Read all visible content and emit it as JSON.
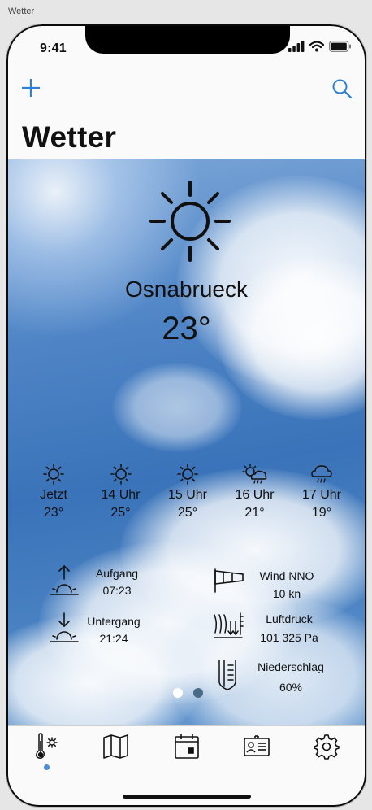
{
  "window": {
    "title": "Wetter"
  },
  "status_bar": {
    "time": "9:41"
  },
  "nav": {
    "title": "Wetter"
  },
  "weather": {
    "city": "Osnabrueck",
    "temperature": "23°",
    "hourly": [
      {
        "label": "Jetzt",
        "temp": "23°",
        "icon": "sun-icon"
      },
      {
        "label": "14 Uhr",
        "temp": "25°",
        "icon": "sun-icon"
      },
      {
        "label": "15 Uhr",
        "temp": "25°",
        "icon": "sun-icon"
      },
      {
        "label": "16 Uhr",
        "temp": "21°",
        "icon": "sun-cloud-rain-icon"
      },
      {
        "label": "17 Uhr",
        "temp": "19°",
        "icon": "cloud-rain-icon"
      }
    ],
    "details": {
      "sunrise_label": "Aufgang",
      "sunrise_value": "07:23",
      "sunset_label": "Untergang",
      "sunset_value": "21:24",
      "wind_label": "Wind NNO",
      "wind_value": "10 kn",
      "pressure_label": "Luftdruck",
      "pressure_value": "101 325 Pa",
      "precip_label": "Niederschlag",
      "precip_value": "60%"
    }
  },
  "pager": {
    "pages": 2,
    "active": 0
  },
  "tabbar": {
    "items": [
      {
        "icon": "thermometer-gear-icon",
        "active": true
      },
      {
        "icon": "map-icon"
      },
      {
        "icon": "calendar-icon"
      },
      {
        "icon": "contact-card-icon"
      },
      {
        "icon": "gear-icon"
      }
    ]
  },
  "colors": {
    "accent": "#2b7fd6",
    "indicator": "#4a8fd6"
  }
}
